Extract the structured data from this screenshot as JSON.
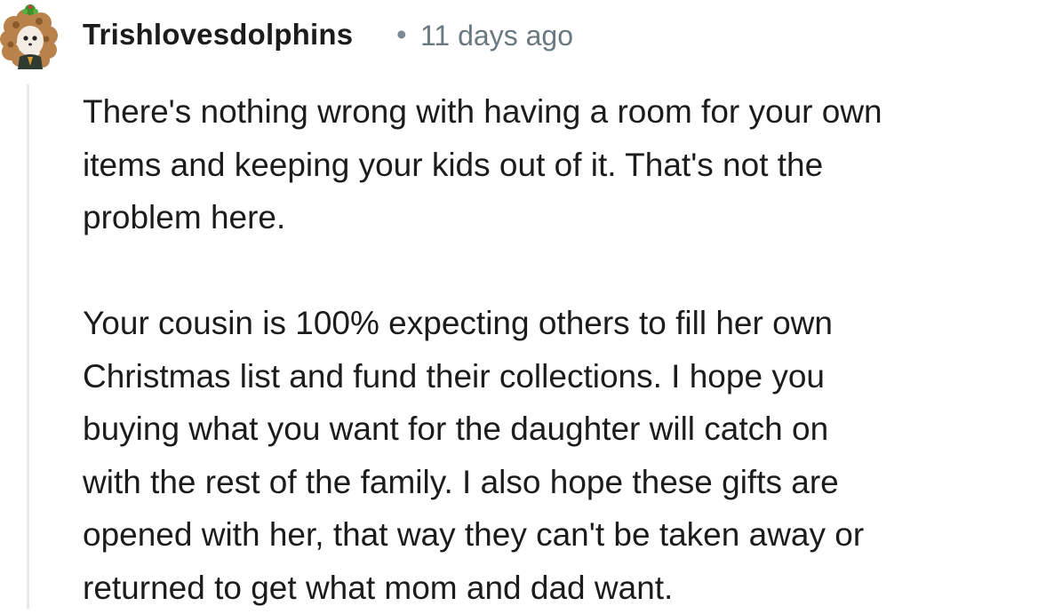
{
  "comment": {
    "username": "Trishlovesdolphins",
    "separator": "•",
    "timestamp": "11 days ago",
    "paragraphs": [
      "There's nothing wrong with having a room for your own\nitems and keeping your kids out of it. That's not the\nproblem here.",
      "Your cousin is 100% expecting others to fill her own\nChristmas list and fund their collections. I hope you\nbuying what you want for the daughter will catch on\nwith the rest of the family. I also hope these gifts are\nopened with her, that way they can't be taken away or\nreturned to get what mom and dad want."
    ]
  },
  "colors": {
    "username": "#1c1c1c",
    "timestamp": "#6a7880",
    "thread_line": "#e6e8ea",
    "avatar_hair": "#b9824a",
    "avatar_hat": "#3f8f2e"
  },
  "icons": {
    "avatar": "user-avatar-icon"
  }
}
